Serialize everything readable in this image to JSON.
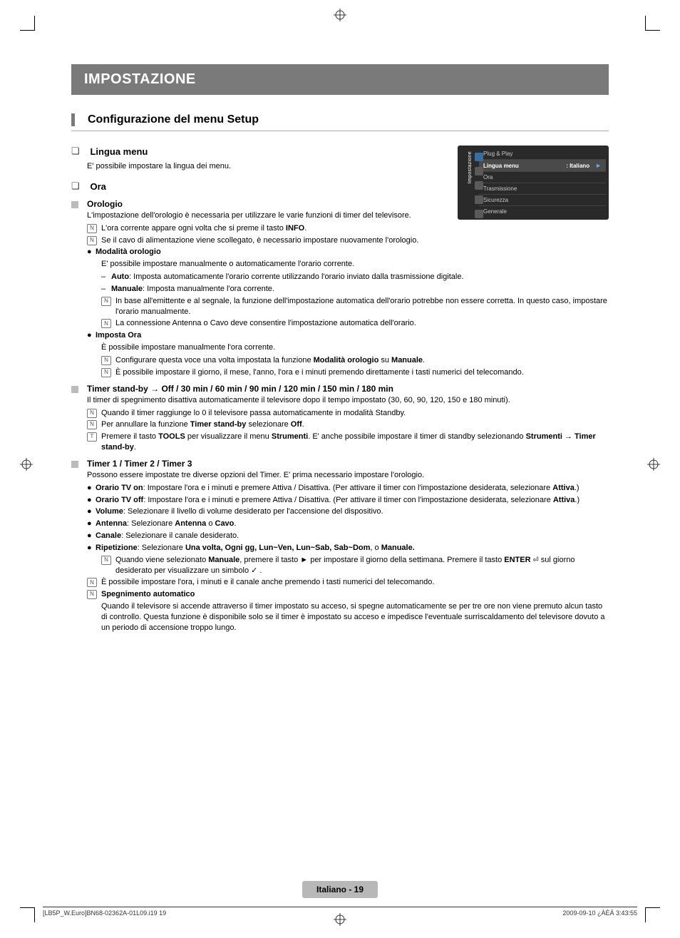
{
  "title_bar": "IMPOSTAZIONE",
  "section_head": "Configurazione del menu Setup",
  "lingua": {
    "title": "Lingua menu",
    "desc": "E' possibile impostare la lingua dei menu."
  },
  "ora": {
    "title": "Ora",
    "orologio_title": "Orologio",
    "orologio_desc": "L'impostazione dell'orologio è necessaria per utilizzare le varie funzioni di timer del televisore.",
    "note1_prefix": "L'ora corrente appare ogni volta che si preme il tasto ",
    "note1_bold": "INFO",
    "note1_suffix": ".",
    "note2": "Se il cavo di alimentazione viene scollegato, è necessario impostare nuovamente l'orologio.",
    "mod_title": "Modalità orologio",
    "mod_desc": "E' possibile impostare manualmente o automaticamente l'orario corrente.",
    "mod_auto_b": "Auto",
    "mod_auto_t": ": Imposta automaticamente l'orario corrente utilizzando l'orario inviato dalla trasmissione digitale.",
    "mod_man_b": "Manuale",
    "mod_man_t": ": Imposta manualmente l'ora corrente.",
    "mod_n1": "In base all'emittente e al segnale, la funzione dell'impostazione automatica dell'orario potrebbe non essere corretta. In questo caso, impostare l'orario manualmente.",
    "mod_n2": "La connessione Antenna o Cavo deve consentire l'impostazione automatica dell'orario.",
    "imp_title": "Imposta Ora",
    "imp_desc": "È possibile impostare manualmente l'ora corrente.",
    "imp_n1_prefix": "Configurare questa voce una volta impostata la funzione ",
    "imp_n1_b1": "Modalità orologio",
    "imp_n1_mid": " su ",
    "imp_n1_b2": "Manuale",
    "imp_n1_suffix": ".",
    "imp_n2": "È possibile impostare il giorno, il mese, l'anno, l'ora e i minuti premendo direttamente i tasti numerici del telecomando."
  },
  "standby": {
    "title": "Timer stand-by  →  Off / 30 min / 60 min / 90 min / 120 min / 150 min / 180 min",
    "desc": "Il timer di spegnimento disattiva automaticamente il televisore dopo il tempo impostato (30, 60, 90, 120, 150 e 180 minuti).",
    "n1": "Quando il timer raggiunge lo 0 il televisore passa automaticamente in modalità Standby.",
    "n2_prefix": "Per annullare la funzione ",
    "n2_b1": "Timer stand-by",
    "n2_mid": " selezionare ",
    "n2_b2": "Off",
    "n2_suffix": ".",
    "t_prefix": "Premere il tasto ",
    "t_b1": "TOOLS",
    "t_mid1": " per visualizzare il menu ",
    "t_b2": "Strumenti",
    "t_mid2": ". E' anche possibile impostare il timer di standby selezionando ",
    "t_b3": "Strumenti → Timer stand-by",
    "t_suffix": "."
  },
  "timer": {
    "title": "Timer 1 / Timer 2 / Timer 3",
    "desc": "Possono essere impostate tre diverse opzioni del Timer. E' prima necessario impostare l'orologio.",
    "on_b": "Orario TV on",
    "on_t": ": Impostare l'ora e i minuti e premere Attiva / Disattiva. (Per attivare il timer con l'impostazione desiderata, selezionare ",
    "on_b2": "Attiva",
    "on_suf": ".)",
    "off_b": "Orario TV off",
    "off_t": ": Impostare l'ora e i minuti e premere Attiva / Disattiva. (Per attivare il timer con l'impostazione desiderata, selezionare ",
    "off_b2": "Attiva",
    "off_suf": ".)",
    "vol_b": "Volume",
    "vol_t": ": Selezionare il livello di volume desiderato per l'accensione del dispositivo.",
    "ant_b": "Antenna",
    "ant_t_pre": ": Selezionare ",
    "ant_t_b1": "Antenna",
    "ant_t_mid": " o ",
    "ant_t_b2": "Cavo",
    "ant_t_suf": ".",
    "can_b": "Canale",
    "can_t": ": Selezionare il canale desiderato.",
    "rip_b": "Ripetizione",
    "rip_t_pre": ": Selezionare ",
    "rip_t_b": "Una volta, Ogni gg, Lun~Ven, Lun~Sab, Sab~Dom",
    "rip_t_mid": ", o ",
    "rip_t_b2": "Manuale.",
    "rip_n_pre": "Quando viene selezionato ",
    "rip_n_b1": "Manuale",
    "rip_n_mid1": ", premere il tasto ► per impostare il giorno della settimana. Premere il tasto ",
    "rip_n_b2": "ENTER",
    "rip_n_mid2": " sul giorno desiderato per visualizzare un simbolo ✓ .",
    "num_n": "È possibile impostare l'ora, i minuti e il canale anche premendo i tasti numerici del telecomando.",
    "speg_b": "Spegnimento automatico",
    "speg_t": "Quando il televisore si accende attraverso il timer impostato su acceso, si spegne automaticamente se per tre ore non viene premuto alcun tasto di controllo. Questa funzione è disponibile solo se il timer è impostato su acceso e impedisce l'eventuale surriscaldamento del televisore dovuto a un periodo di accensione troppo lungo."
  },
  "osd": {
    "side": "Impostazione",
    "r1": "Plug & Play",
    "r2l": "Lingua menu",
    "r2r": ": Italiano",
    "r3": "Ora",
    "r4": "Trasmissione",
    "r5": "Sicurezza",
    "r6": "Generale"
  },
  "footer_page": "Italiano - 19",
  "footer_left": "[LB5P_W.Euro]BN68-02362A-01L09.i19   19",
  "footer_right": "2009-09-10   ¿ÀÈÄ 3:43:55"
}
